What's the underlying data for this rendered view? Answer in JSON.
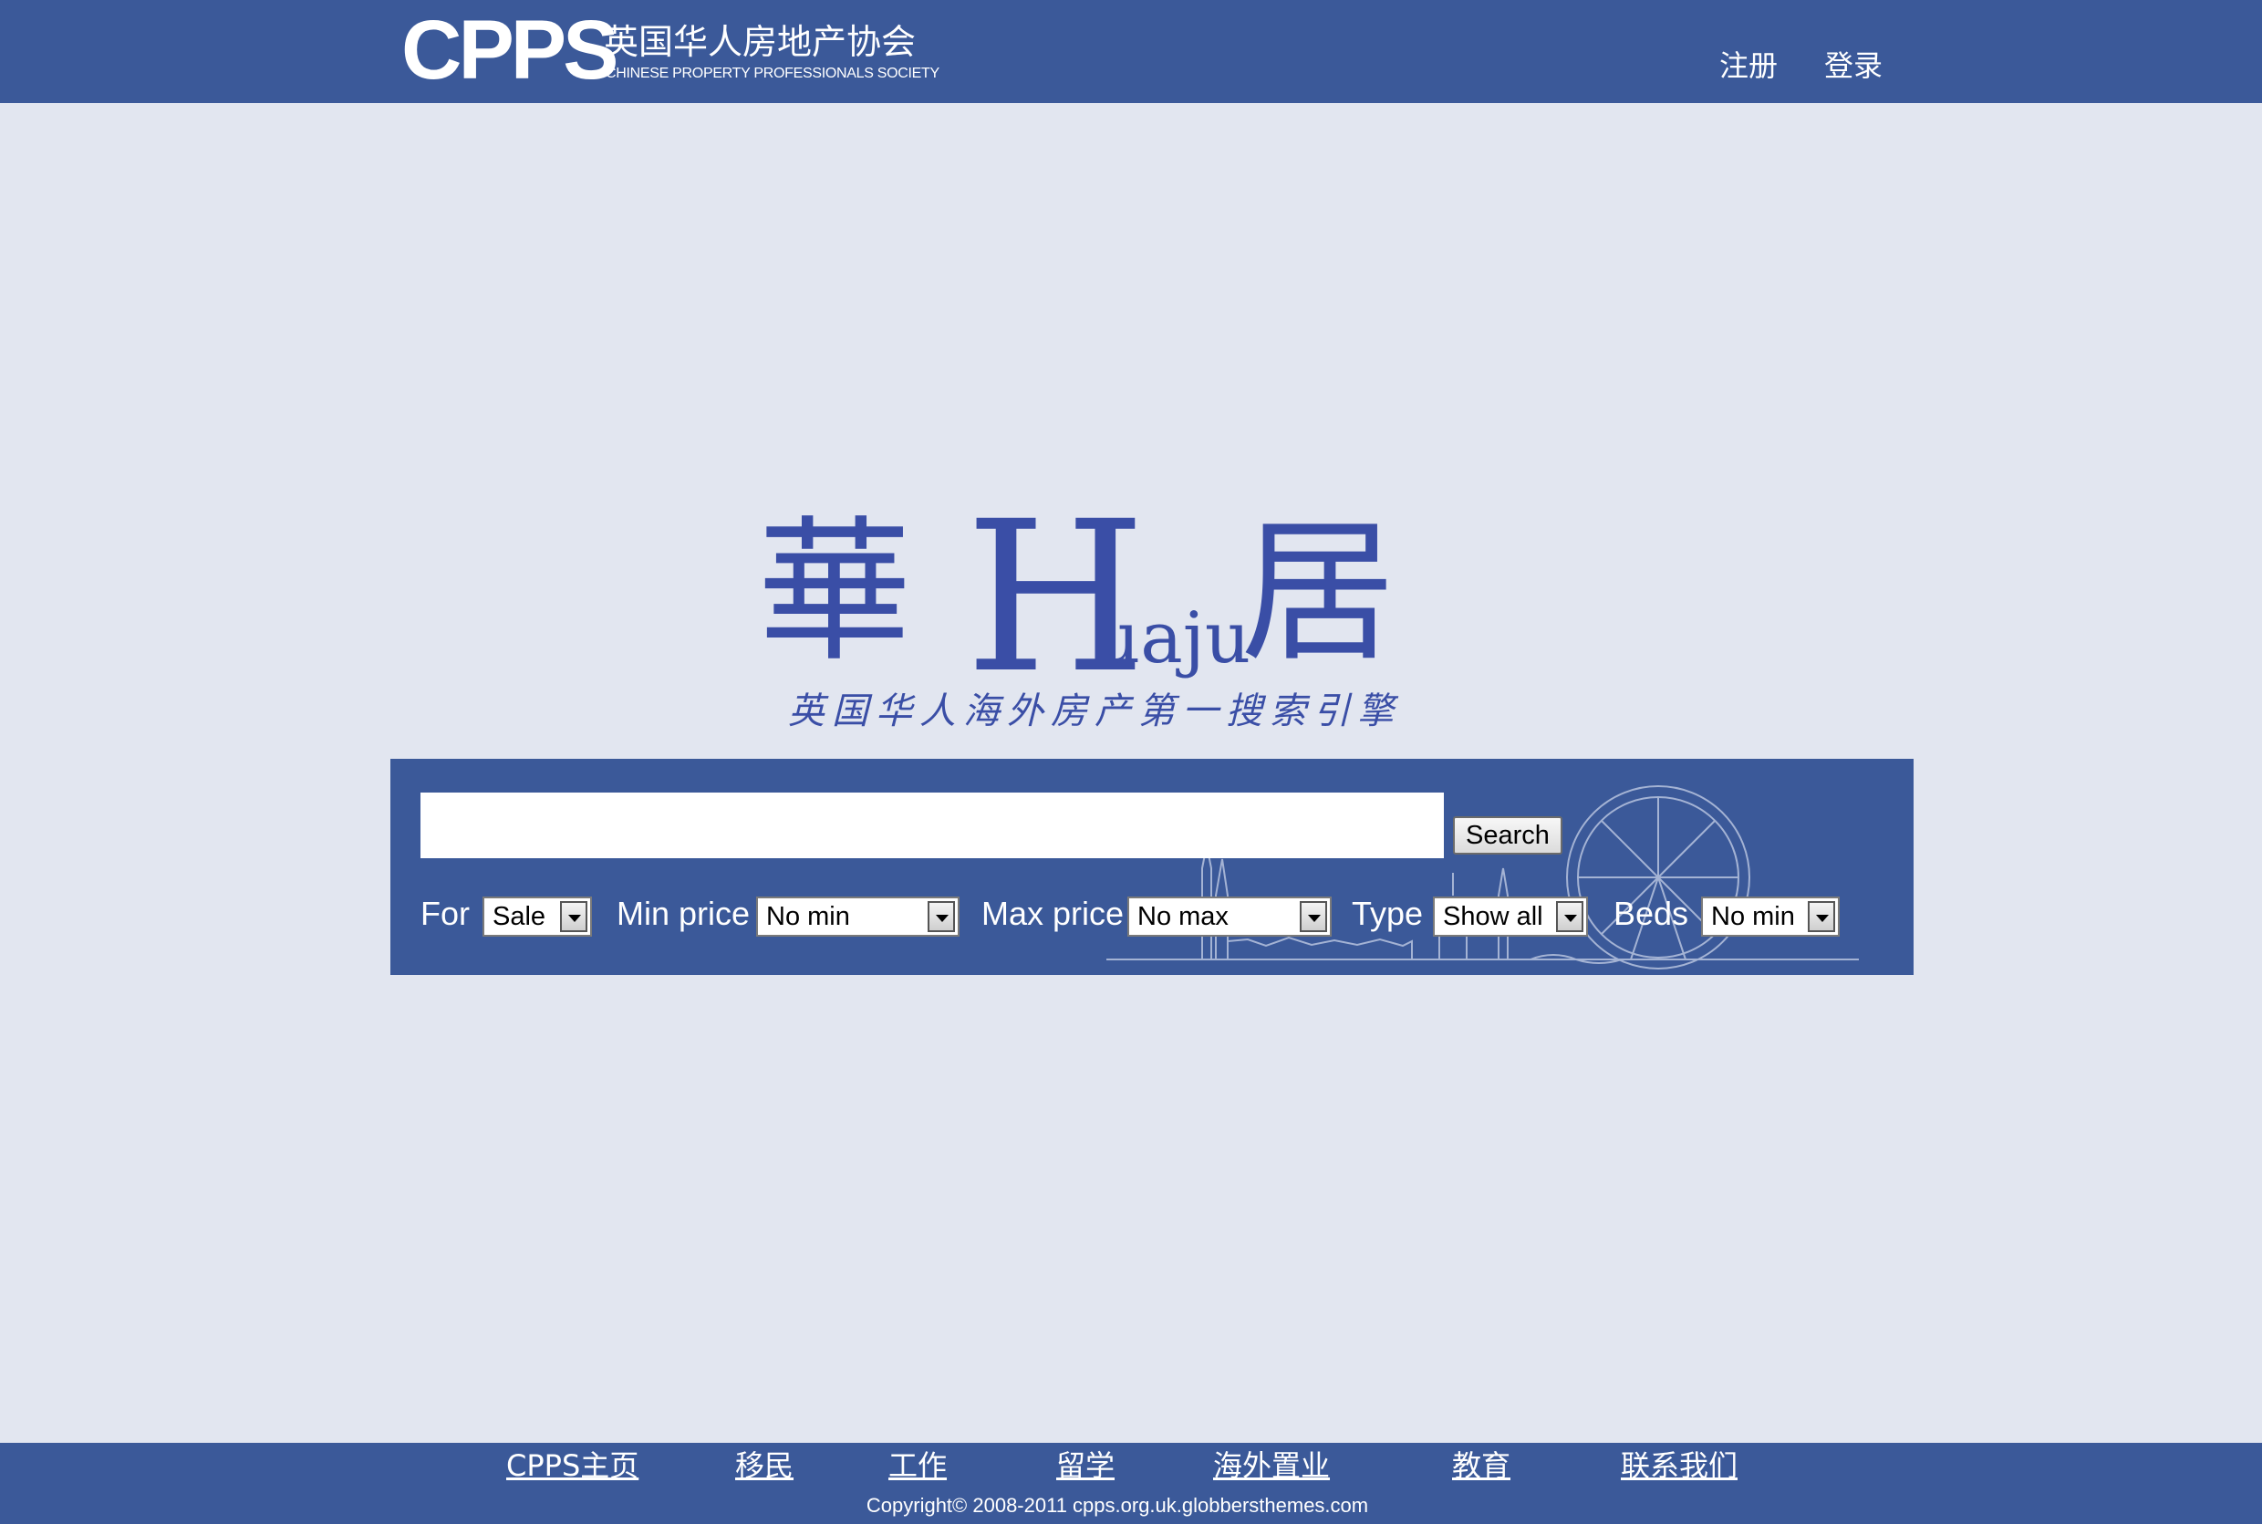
{
  "header": {
    "logo_mark": "CPPS",
    "logo_cn": "英国华人房地产协会",
    "logo_en": "CHINESE PROPERTY PROFESSIONALS SOCIETY",
    "nav": {
      "register": "注册",
      "login": "登录"
    }
  },
  "brand": {
    "hua": "華",
    "H": "H",
    "uaju": "uaju",
    "ju": "居",
    "tagline": "英国华人海外房产第一搜索引擎"
  },
  "search": {
    "query_value": "",
    "button_label": "Search",
    "filters": {
      "for_label": "For",
      "for_value": "Sale",
      "min_price_label": "Min price",
      "min_price_value": "No min",
      "max_price_label": "Max price",
      "max_price_value": "No max",
      "type_label": "Type",
      "type_value": "Show all",
      "beds_label": "Beds",
      "beds_value": "No min"
    }
  },
  "footer": {
    "links": {
      "home": "CPPS主页",
      "immigration": "移民",
      "work": "工作",
      "study": "留学",
      "overseas_property": "海外置业",
      "education": "教育",
      "contact": "联系我们"
    },
    "copyright": "Copyright© 2008-2011 cpps.org.uk.globbersthemes.com"
  },
  "colors": {
    "bar_blue": "#3b5999",
    "page_bg": "#e2e6f0",
    "brand_blue": "#3a4ea6"
  }
}
